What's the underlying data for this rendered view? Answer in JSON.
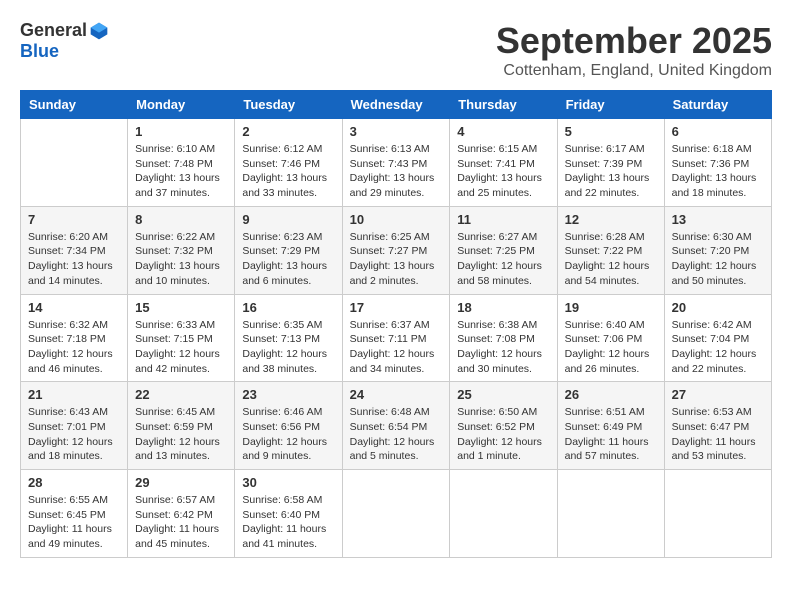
{
  "logo": {
    "general": "General",
    "blue": "Blue"
  },
  "title": "September 2025",
  "location": "Cottenham, England, United Kingdom",
  "days_of_week": [
    "Sunday",
    "Monday",
    "Tuesday",
    "Wednesday",
    "Thursday",
    "Friday",
    "Saturday"
  ],
  "weeks": [
    [
      {
        "day": "",
        "sunrise": "",
        "sunset": "",
        "daylight": ""
      },
      {
        "day": "1",
        "sunrise": "Sunrise: 6:10 AM",
        "sunset": "Sunset: 7:48 PM",
        "daylight": "Daylight: 13 hours and 37 minutes."
      },
      {
        "day": "2",
        "sunrise": "Sunrise: 6:12 AM",
        "sunset": "Sunset: 7:46 PM",
        "daylight": "Daylight: 13 hours and 33 minutes."
      },
      {
        "day": "3",
        "sunrise": "Sunrise: 6:13 AM",
        "sunset": "Sunset: 7:43 PM",
        "daylight": "Daylight: 13 hours and 29 minutes."
      },
      {
        "day": "4",
        "sunrise": "Sunrise: 6:15 AM",
        "sunset": "Sunset: 7:41 PM",
        "daylight": "Daylight: 13 hours and 25 minutes."
      },
      {
        "day": "5",
        "sunrise": "Sunrise: 6:17 AM",
        "sunset": "Sunset: 7:39 PM",
        "daylight": "Daylight: 13 hours and 22 minutes."
      },
      {
        "day": "6",
        "sunrise": "Sunrise: 6:18 AM",
        "sunset": "Sunset: 7:36 PM",
        "daylight": "Daylight: 13 hours and 18 minutes."
      }
    ],
    [
      {
        "day": "7",
        "sunrise": "Sunrise: 6:20 AM",
        "sunset": "Sunset: 7:34 PM",
        "daylight": "Daylight: 13 hours and 14 minutes."
      },
      {
        "day": "8",
        "sunrise": "Sunrise: 6:22 AM",
        "sunset": "Sunset: 7:32 PM",
        "daylight": "Daylight: 13 hours and 10 minutes."
      },
      {
        "day": "9",
        "sunrise": "Sunrise: 6:23 AM",
        "sunset": "Sunset: 7:29 PM",
        "daylight": "Daylight: 13 hours and 6 minutes."
      },
      {
        "day": "10",
        "sunrise": "Sunrise: 6:25 AM",
        "sunset": "Sunset: 7:27 PM",
        "daylight": "Daylight: 13 hours and 2 minutes."
      },
      {
        "day": "11",
        "sunrise": "Sunrise: 6:27 AM",
        "sunset": "Sunset: 7:25 PM",
        "daylight": "Daylight: 12 hours and 58 minutes."
      },
      {
        "day": "12",
        "sunrise": "Sunrise: 6:28 AM",
        "sunset": "Sunset: 7:22 PM",
        "daylight": "Daylight: 12 hours and 54 minutes."
      },
      {
        "day": "13",
        "sunrise": "Sunrise: 6:30 AM",
        "sunset": "Sunset: 7:20 PM",
        "daylight": "Daylight: 12 hours and 50 minutes."
      }
    ],
    [
      {
        "day": "14",
        "sunrise": "Sunrise: 6:32 AM",
        "sunset": "Sunset: 7:18 PM",
        "daylight": "Daylight: 12 hours and 46 minutes."
      },
      {
        "day": "15",
        "sunrise": "Sunrise: 6:33 AM",
        "sunset": "Sunset: 7:15 PM",
        "daylight": "Daylight: 12 hours and 42 minutes."
      },
      {
        "day": "16",
        "sunrise": "Sunrise: 6:35 AM",
        "sunset": "Sunset: 7:13 PM",
        "daylight": "Daylight: 12 hours and 38 minutes."
      },
      {
        "day": "17",
        "sunrise": "Sunrise: 6:37 AM",
        "sunset": "Sunset: 7:11 PM",
        "daylight": "Daylight: 12 hours and 34 minutes."
      },
      {
        "day": "18",
        "sunrise": "Sunrise: 6:38 AM",
        "sunset": "Sunset: 7:08 PM",
        "daylight": "Daylight: 12 hours and 30 minutes."
      },
      {
        "day": "19",
        "sunrise": "Sunrise: 6:40 AM",
        "sunset": "Sunset: 7:06 PM",
        "daylight": "Daylight: 12 hours and 26 minutes."
      },
      {
        "day": "20",
        "sunrise": "Sunrise: 6:42 AM",
        "sunset": "Sunset: 7:04 PM",
        "daylight": "Daylight: 12 hours and 22 minutes."
      }
    ],
    [
      {
        "day": "21",
        "sunrise": "Sunrise: 6:43 AM",
        "sunset": "Sunset: 7:01 PM",
        "daylight": "Daylight: 12 hours and 18 minutes."
      },
      {
        "day": "22",
        "sunrise": "Sunrise: 6:45 AM",
        "sunset": "Sunset: 6:59 PM",
        "daylight": "Daylight: 12 hours and 13 minutes."
      },
      {
        "day": "23",
        "sunrise": "Sunrise: 6:46 AM",
        "sunset": "Sunset: 6:56 PM",
        "daylight": "Daylight: 12 hours and 9 minutes."
      },
      {
        "day": "24",
        "sunrise": "Sunrise: 6:48 AM",
        "sunset": "Sunset: 6:54 PM",
        "daylight": "Daylight: 12 hours and 5 minutes."
      },
      {
        "day": "25",
        "sunrise": "Sunrise: 6:50 AM",
        "sunset": "Sunset: 6:52 PM",
        "daylight": "Daylight: 12 hours and 1 minute."
      },
      {
        "day": "26",
        "sunrise": "Sunrise: 6:51 AM",
        "sunset": "Sunset: 6:49 PM",
        "daylight": "Daylight: 11 hours and 57 minutes."
      },
      {
        "day": "27",
        "sunrise": "Sunrise: 6:53 AM",
        "sunset": "Sunset: 6:47 PM",
        "daylight": "Daylight: 11 hours and 53 minutes."
      }
    ],
    [
      {
        "day": "28",
        "sunrise": "Sunrise: 6:55 AM",
        "sunset": "Sunset: 6:45 PM",
        "daylight": "Daylight: 11 hours and 49 minutes."
      },
      {
        "day": "29",
        "sunrise": "Sunrise: 6:57 AM",
        "sunset": "Sunset: 6:42 PM",
        "daylight": "Daylight: 11 hours and 45 minutes."
      },
      {
        "day": "30",
        "sunrise": "Sunrise: 6:58 AM",
        "sunset": "Sunset: 6:40 PM",
        "daylight": "Daylight: 11 hours and 41 minutes."
      },
      {
        "day": "",
        "sunrise": "",
        "sunset": "",
        "daylight": ""
      },
      {
        "day": "",
        "sunrise": "",
        "sunset": "",
        "daylight": ""
      },
      {
        "day": "",
        "sunrise": "",
        "sunset": "",
        "daylight": ""
      },
      {
        "day": "",
        "sunrise": "",
        "sunset": "",
        "daylight": ""
      }
    ]
  ]
}
